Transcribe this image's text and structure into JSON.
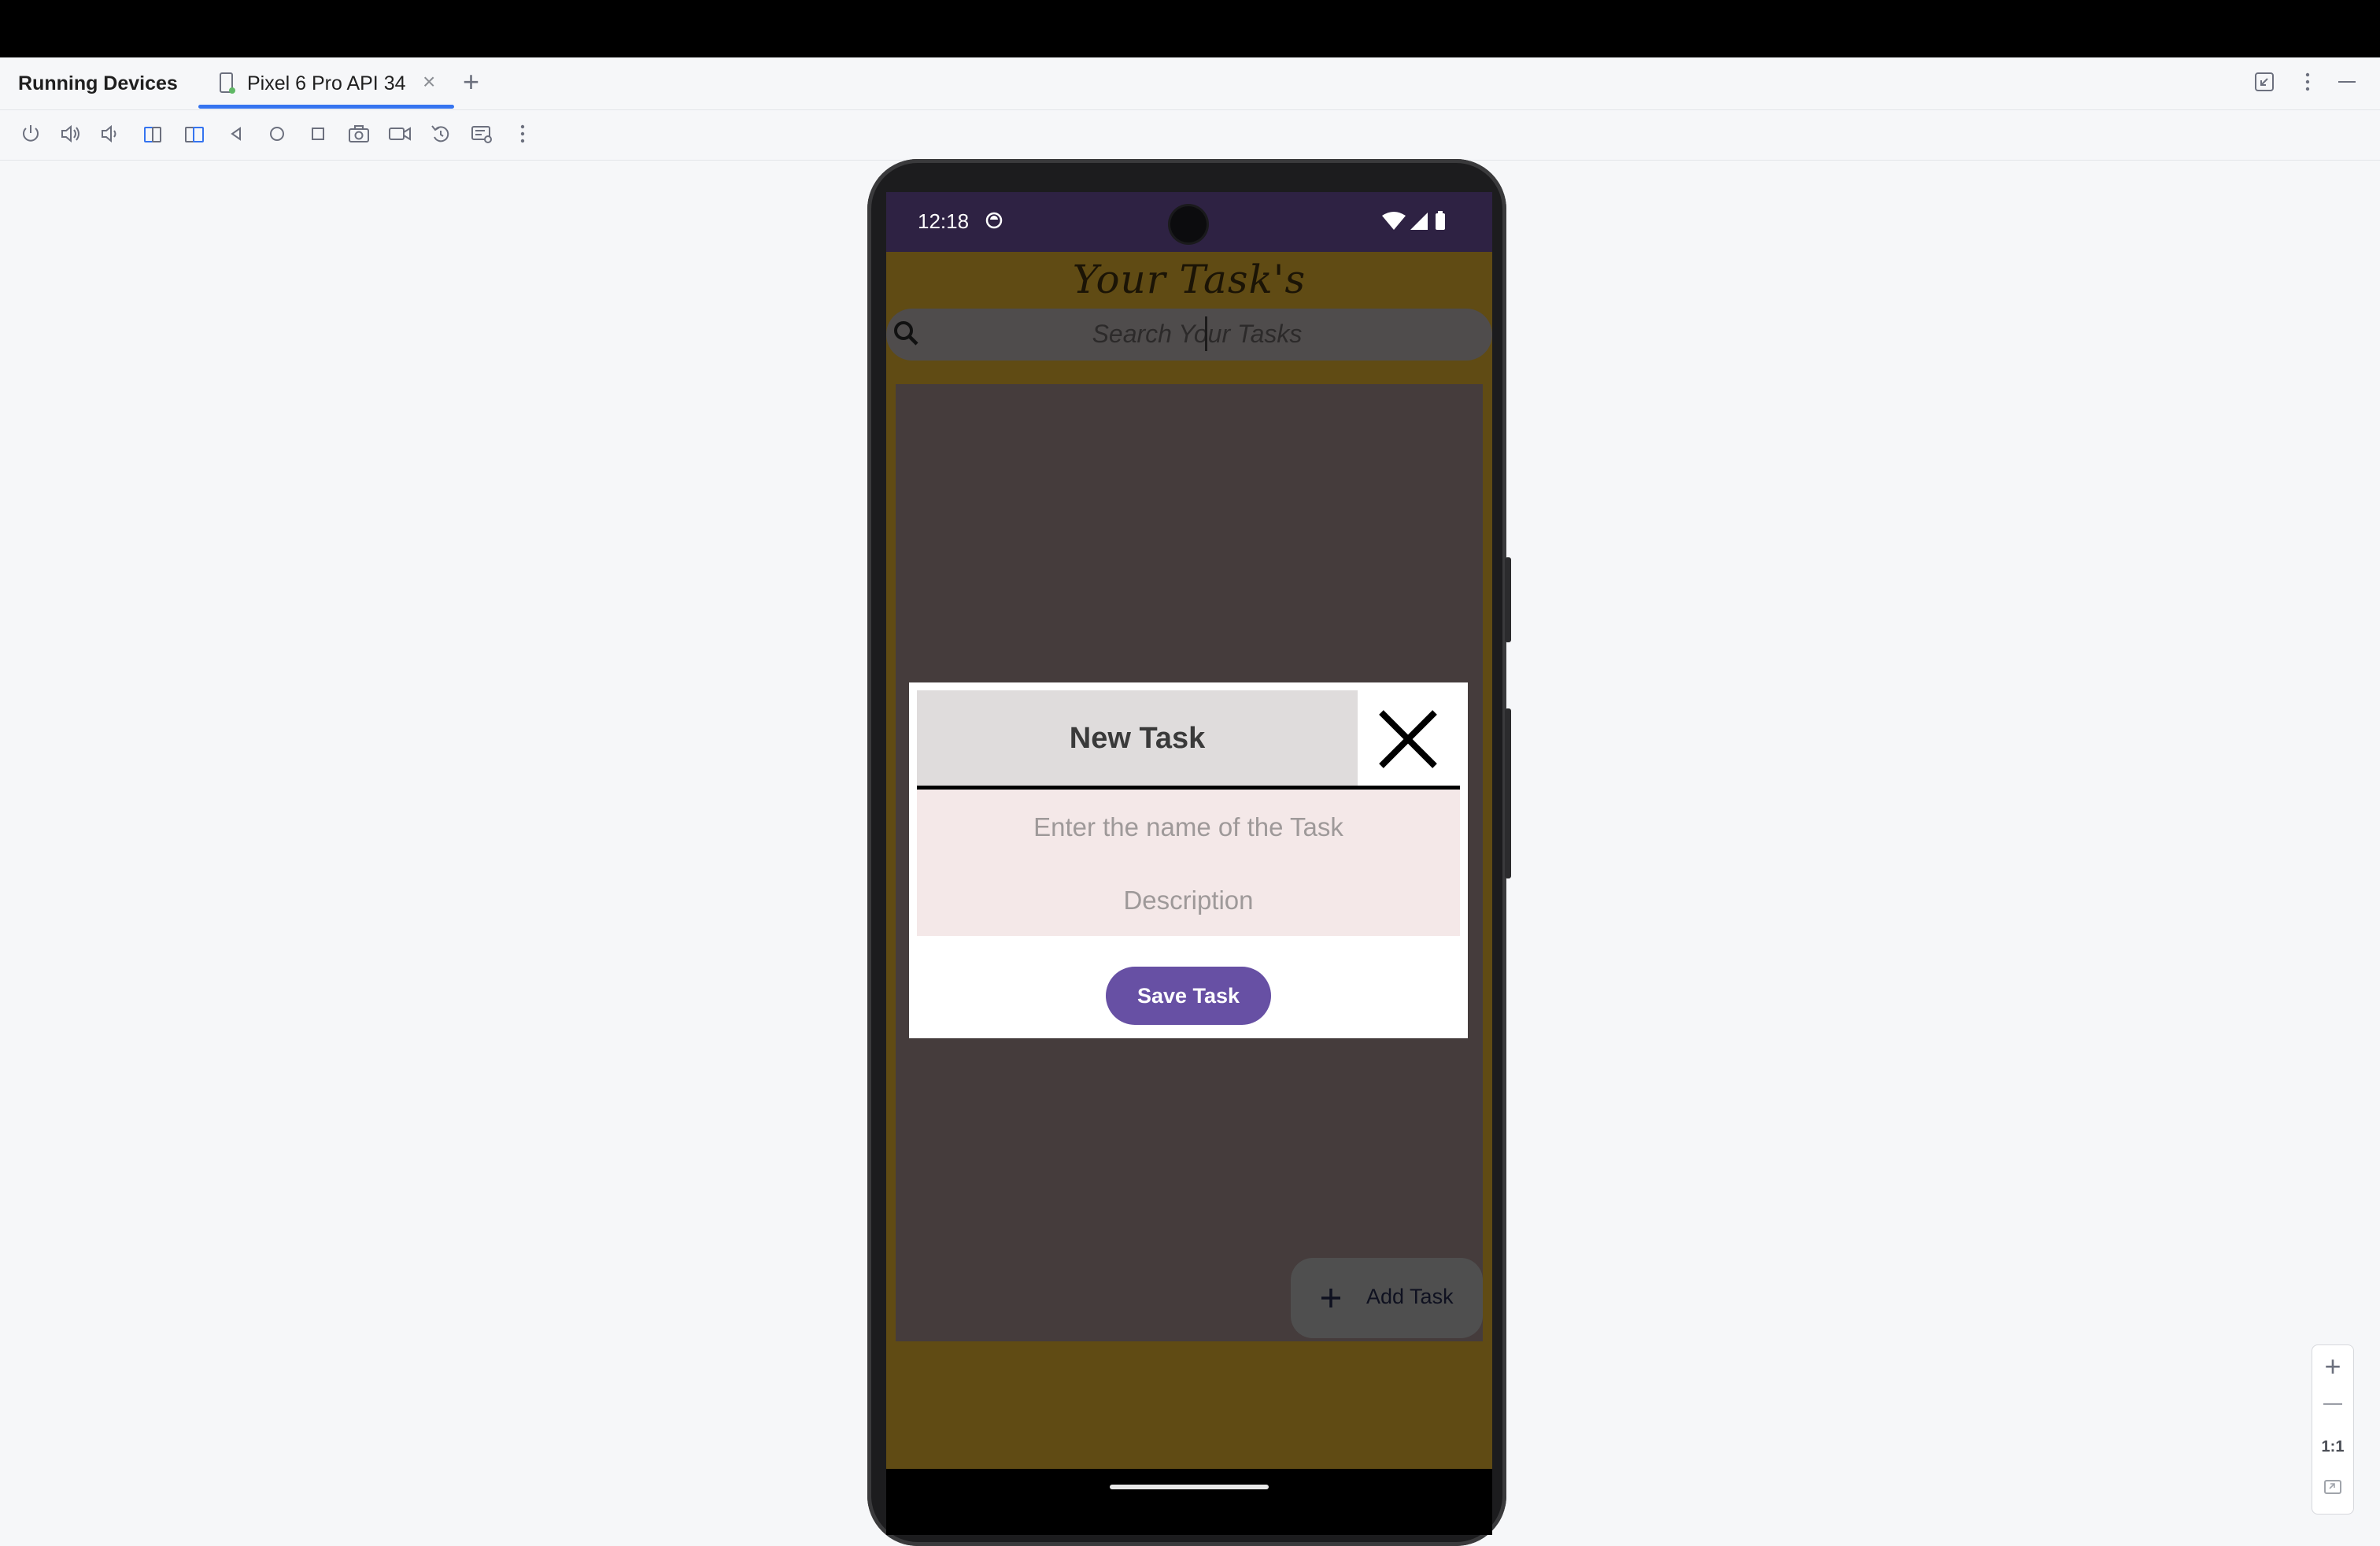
{
  "ide": {
    "panel_title": "Running Devices",
    "device_tab_label": "Pixel 6 Pro API 34",
    "tab_close_glyph": "×",
    "add_tab_glyph": "+",
    "toolbar_icons": [
      "power-icon",
      "volume-up-icon",
      "volume-down-icon",
      "rotate-left-icon",
      "rotate-right-icon",
      "back-icon",
      "home-icon",
      "overview-icon",
      "screenshot-icon",
      "screen-record-icon",
      "reset-icon",
      "display-settings-icon",
      "more-options-icon"
    ],
    "accent_color": "#3574f0"
  },
  "phone": {
    "status": {
      "time": "12:18"
    },
    "app": {
      "title": "Your Task's",
      "search_placeholder": "Search Your Tasks",
      "fab_label": "Add Task",
      "colors": {
        "background": "#604b14",
        "list": "#453c3c",
        "status_bar": "#2e2243"
      }
    },
    "dialog": {
      "title": "New Task",
      "name_placeholder": "Enter the name of the Task",
      "description_placeholder": "Description",
      "save_label": "Save Task",
      "colors": {
        "save_button": "#6750a4",
        "fields_bg": "#f4e8e8",
        "header_bg": "#dfdcdc"
      }
    }
  },
  "zoom": {
    "zoom_in": "+",
    "zoom_out": "—",
    "actual_size": "1:1"
  }
}
